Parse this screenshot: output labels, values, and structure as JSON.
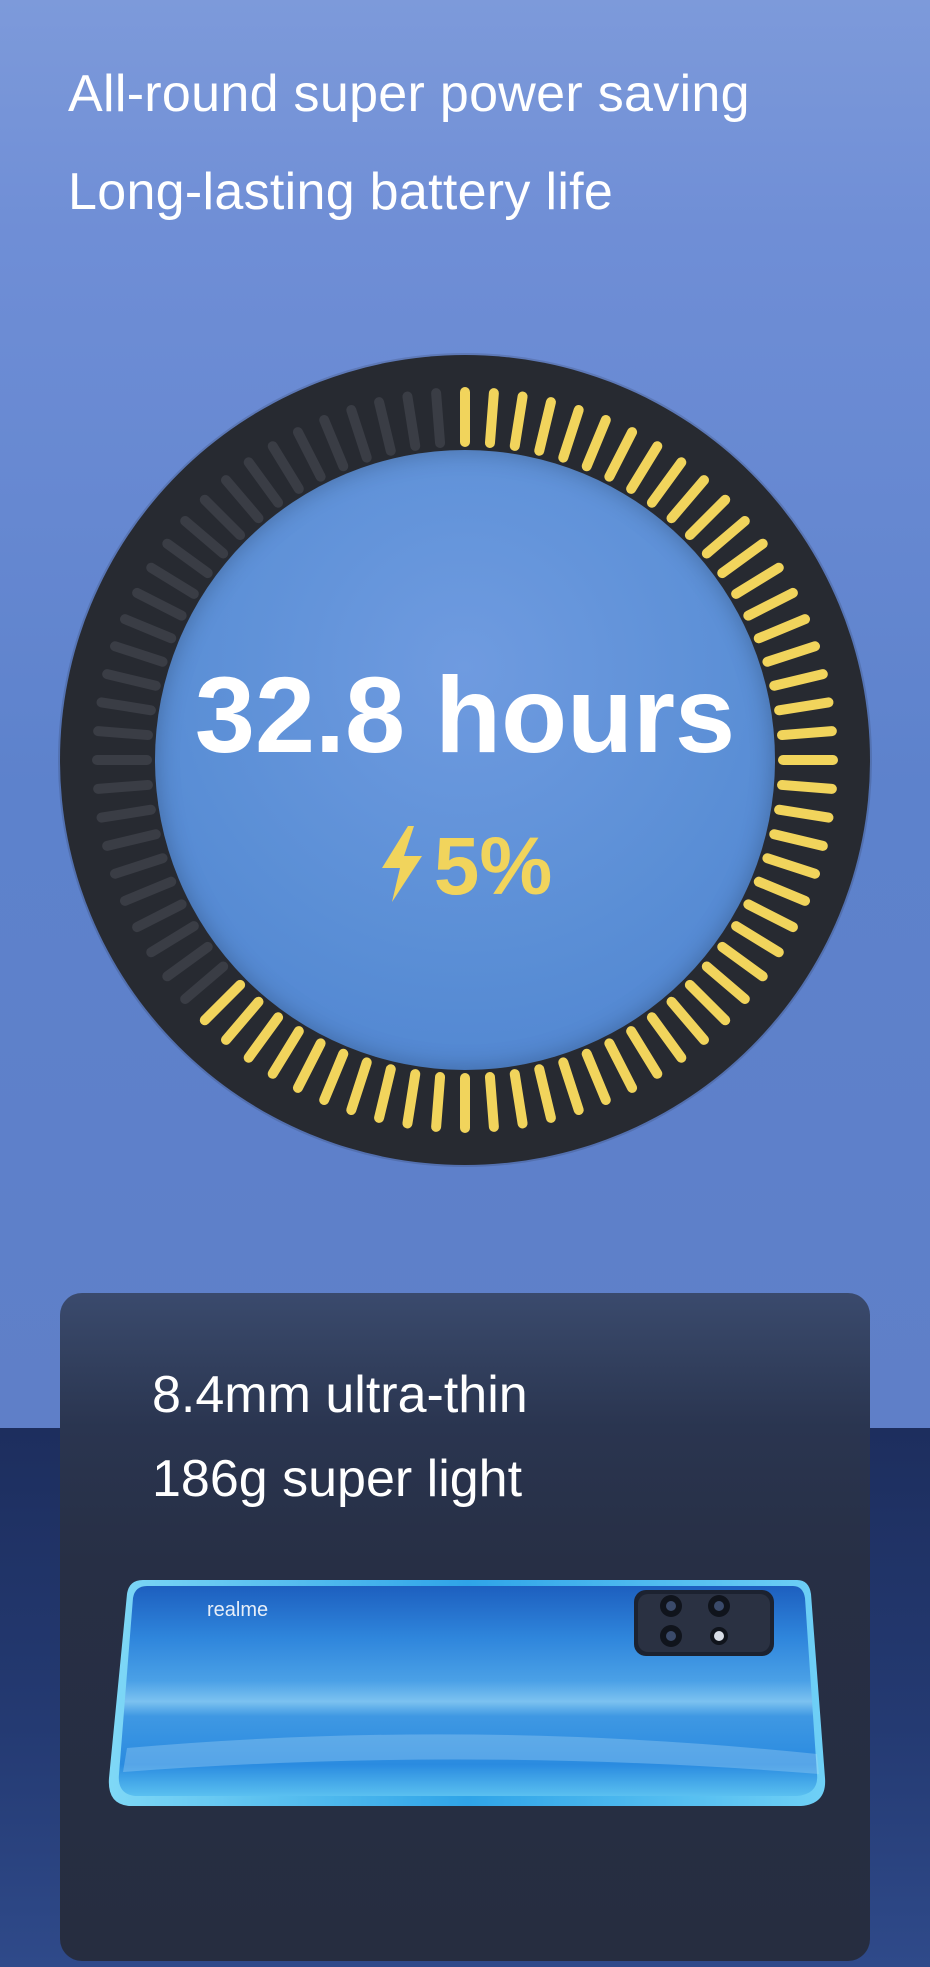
{
  "header": {
    "line1": "All-round super power saving",
    "line2": "Long-lasting battery life"
  },
  "dial": {
    "hours_label": "32.8 hours",
    "battery_label": "5%",
    "charge_level_percent": 5,
    "colors": {
      "active_tick": "#f1d45c",
      "inactive_tick": "#3a3d45",
      "ring": "#272a31"
    },
    "icon": "lightning-bolt-icon"
  },
  "card": {
    "line1": "8.4mm ultra-thin",
    "line2": "186g super light"
  },
  "phone": {
    "brand": "realme",
    "icon": "camera-module-icon"
  }
}
